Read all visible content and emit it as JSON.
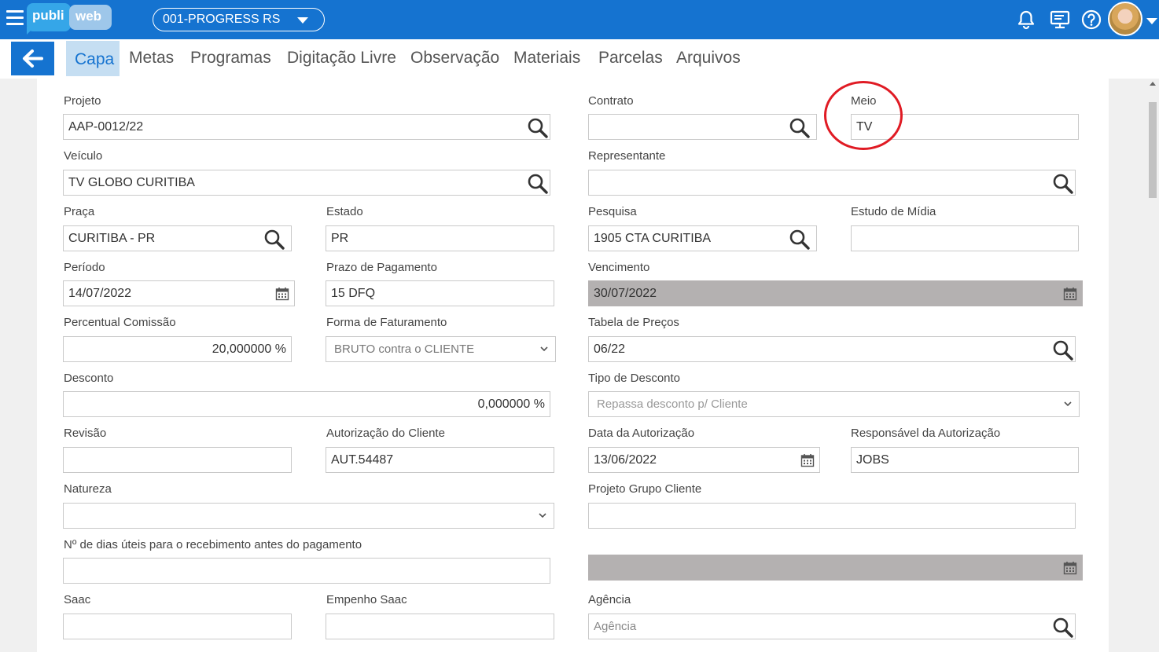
{
  "app": {
    "logo_left": "publi",
    "logo_right": "web",
    "company_selector": "001-PROGRESS RS",
    "icons": [
      "menu-icon",
      "bell-icon",
      "monitor-icon",
      "help-icon",
      "avatar",
      "chevron-down-icon"
    ]
  },
  "tabs": [
    "Capa",
    "Metas",
    "Programas",
    "Digitação Livre",
    "Observação",
    "Materiais",
    "Parcelas",
    "Arquivos"
  ],
  "active_tab": "Capa",
  "form": {
    "projeto": {
      "label": "Projeto",
      "value": "AAP-0012/22"
    },
    "contrato": {
      "label": "Contrato",
      "value": ""
    },
    "meio": {
      "label": "Meio",
      "value": "TV"
    },
    "veiculo": {
      "label": "Veículo",
      "value": "TV GLOBO CURITIBA"
    },
    "representante": {
      "label": "Representante",
      "value": ""
    },
    "praca": {
      "label": "Praça",
      "value": "CURITIBA - PR"
    },
    "estado": {
      "label": "Estado",
      "value": "PR"
    },
    "pesquisa": {
      "label": "Pesquisa",
      "value": "1905 CTA CURITIBA"
    },
    "estudo_midia": {
      "label": "Estudo de Mídia",
      "value": ""
    },
    "periodo": {
      "label": "Período",
      "value": "14/07/2022"
    },
    "prazo_pagamento": {
      "label": "Prazo de Pagamento",
      "value": "15 DFQ"
    },
    "vencimento": {
      "label": "Vencimento",
      "value": "30/07/2022"
    },
    "percentual_comissao": {
      "label": "Percentual Comissão",
      "value": "20,000000 %"
    },
    "forma_faturamento": {
      "label": "Forma de Faturamento",
      "value": "BRUTO contra o CLIENTE"
    },
    "tabela_precos": {
      "label": "Tabela de Preços",
      "value": "06/22"
    },
    "desconto": {
      "label": "Desconto",
      "value": "0,000000 %"
    },
    "tipo_desconto": {
      "label": "Tipo de Desconto",
      "placeholder": "Repassa desconto p/ Cliente"
    },
    "revisao": {
      "label": "Revisão",
      "value": ""
    },
    "autorizacao_cliente": {
      "label": "Autorização do Cliente",
      "value": "AUT.54487"
    },
    "data_autorizacao": {
      "label": "Data da Autorização",
      "value": "13/06/2022"
    },
    "responsavel_autorizacao": {
      "label": "Responsável da Autorização",
      "value": "JOBS"
    },
    "natureza": {
      "label": "Natureza",
      "value": ""
    },
    "projeto_grupo_cliente": {
      "label": "Projeto Grupo Cliente",
      "value": ""
    },
    "dias_uteis": {
      "label": "Nº de dias úteis para o recebimento antes do pagamento",
      "value": ""
    },
    "data_extra": {
      "value": ""
    },
    "saac": {
      "label": "Saac",
      "value": ""
    },
    "empenho_saac": {
      "label": "Empenho Saac",
      "value": ""
    },
    "agencia": {
      "label": "Agência",
      "placeholder": "Agência"
    }
  },
  "colors": {
    "primary": "#1573d0",
    "active_tab_bg": "#c5def2",
    "disabled_bg": "#b4b1b1",
    "annotation": "#e01b24"
  }
}
